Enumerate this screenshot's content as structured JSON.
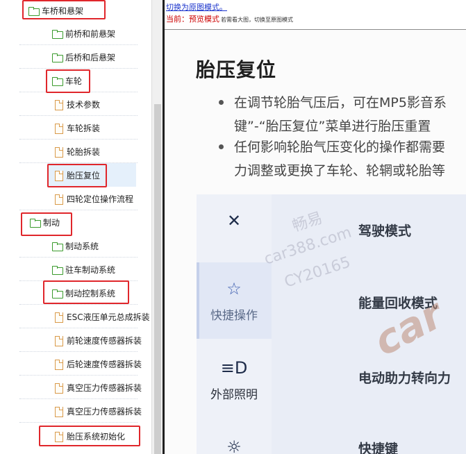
{
  "tree": {
    "items": [
      {
        "label": "车桥和悬架",
        "type": "folder"
      },
      {
        "label": "前桥和前悬架",
        "type": "folder"
      },
      {
        "label": "后桥和后悬架",
        "type": "folder"
      },
      {
        "label": "车轮",
        "type": "folder"
      },
      {
        "label": "技术参数",
        "type": "doc"
      },
      {
        "label": "车轮拆装",
        "type": "doc"
      },
      {
        "label": "轮胎拆装",
        "type": "doc"
      },
      {
        "label": "胎压复位",
        "type": "doc"
      },
      {
        "label": "四轮定位操作流程",
        "type": "doc"
      },
      {
        "label": "制动",
        "type": "folder"
      },
      {
        "label": "制动系统",
        "type": "folder"
      },
      {
        "label": "驻车制动系统",
        "type": "folder"
      },
      {
        "label": "制动控制系统",
        "type": "folder"
      },
      {
        "label": "ESC液压单元总成拆装",
        "type": "doc"
      },
      {
        "label": "前轮速度传感器拆装",
        "type": "doc"
      },
      {
        "label": "后轮速度传感器拆装",
        "type": "doc"
      },
      {
        "label": "真空压力传感器拆装",
        "type": "doc"
      },
      {
        "label": "真空压力传感器拆装",
        "type": "doc"
      },
      {
        "label": "胎压系统初始化",
        "type": "doc"
      }
    ]
  },
  "viewer": {
    "switch_link": "切换为原图模式",
    "switch_link_dot": "。",
    "mode_prefix": "当前：",
    "mode_value": "预览模式",
    "mode_note": "若需看大图，切换至原图模式"
  },
  "document": {
    "title": "胎压复位",
    "bullets": [
      {
        "line1": "在调节轮胎气压后，可在MP5影音系",
        "line2": "键”-“胎压复位”菜单进行胎压重置"
      },
      {
        "line1": "任何影响轮胎气压变化的操作都需要",
        "line2": "力调整或更换了车轮、轮辋或轮胎等"
      }
    ],
    "screen": {
      "side_items": [
        {
          "icon": "close-x-icon",
          "glyph": "✕",
          "label": ""
        },
        {
          "icon": "star-icon",
          "glyph": "☆",
          "label": "快捷操作"
        },
        {
          "icon": "headlight-icon",
          "glyph": "≡D",
          "label": "外部照明"
        },
        {
          "icon": "brightness-icon",
          "glyph": "☼",
          "label": ""
        }
      ],
      "rows": [
        "驾驶模式",
        "能量回收模式",
        "电动助力转向力",
        "快捷键"
      ]
    },
    "watermark": {
      "line1": "畅易",
      "line2": "car388.com",
      "line3": "CY20165",
      "big": "car"
    }
  },
  "colors": {
    "highlight_box": "#e0262b",
    "folder_icon": "#3a9a2c",
    "doc_icon": "#d99a4a",
    "link": "#1a33cc",
    "mode_text": "#cc0000"
  }
}
